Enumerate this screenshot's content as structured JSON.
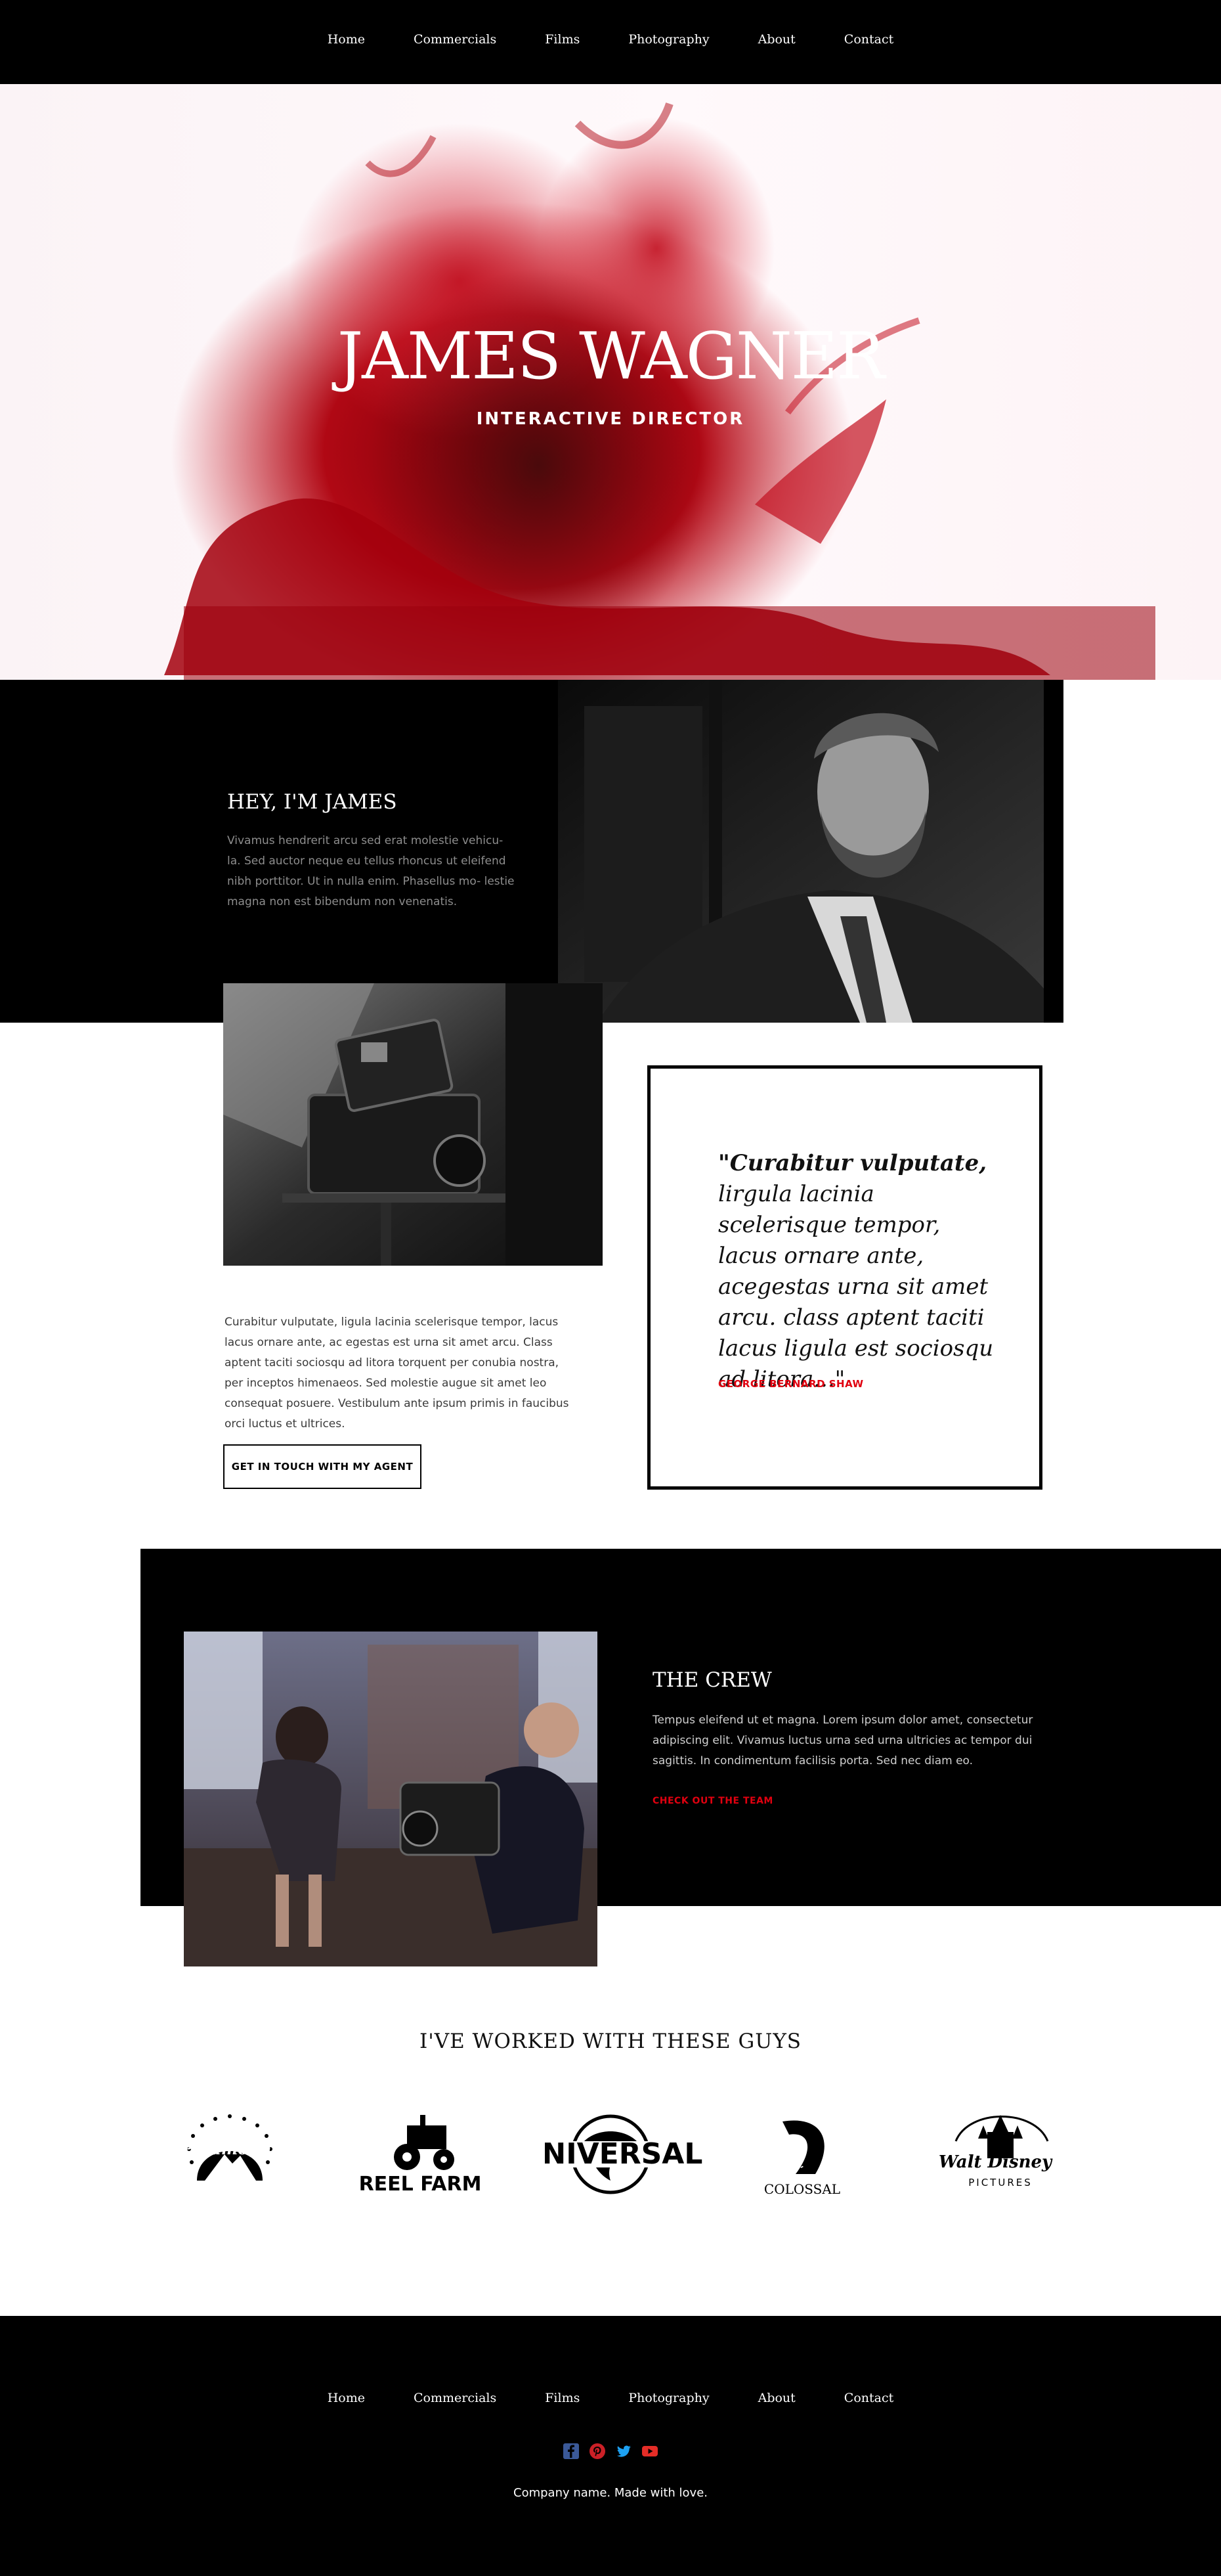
{
  "nav": {
    "items": [
      "Home",
      "Commercials",
      "Films",
      "Photography",
      "About",
      "Contact"
    ]
  },
  "hero": {
    "title": "JAMES WAGNER",
    "subtitle": "INTERACTIVE DIRECTOR"
  },
  "about": {
    "title": "HEY, I'M JAMES",
    "text": "Vivamus hendrerit arcu sed erat molestie vehicu- la. Sed auctor neque eu tellus rhoncus ut eleifend nibh porttitor. Ut in nulla enim. Phasellus mo- lestie magna non est bibendum non venenatis."
  },
  "intro": {
    "text": "Curabitur vulputate, ligula lacinia scelerisque tempor, lacus lacus ornare ante, ac egestas est urna sit amet arcu. Class aptent taciti sociosqu ad litora torquent per conubia nostra, per inceptos himenaeos. Sed molestie augue sit amet leo consequat posuere. Vestibulum ante ipsum primis in faucibus orci luctus et ultrices.",
    "button_label": "GET IN TOUCH WITH MY AGENT"
  },
  "quote": {
    "lead": "\"Curabitur vulputate,",
    "rest": "lirgula lacinia scelerisque tempor, lacus ornare ante, acegestas urna sit amet arcu. class aptent taciti lacus ligula est sociosqu ad litora...\"",
    "author": "GEORGE BERNARD SHAW"
  },
  "crew": {
    "title": "THE CREW",
    "text": "Tempus eleifend ut et magna. Lorem ipsum dolor amet, consectetur adipiscing elit. Vivamus luctus urna sed urna ultricies ac tempor dui sagittis. In condimentum facilisis porta. Sed nec diam eo.",
    "link": "CHECK OUT THE TEAM"
  },
  "partners": {
    "title": "I'VE WORKED WITH THESE GUYS",
    "logos": [
      {
        "name": "paramount",
        "text": "Paramount"
      },
      {
        "name": "reel-farm",
        "text": "REEL FARM"
      },
      {
        "name": "universal",
        "text": "UNIVERSAL"
      },
      {
        "name": "colossal",
        "text": "COLOSSAL"
      },
      {
        "name": "walt-disney",
        "text": "Walt Disney",
        "sub": "PICTURES"
      }
    ]
  },
  "footer": {
    "nav": [
      "Home",
      "Commercials",
      "Films",
      "Photography",
      "About",
      "Contact"
    ],
    "social": [
      {
        "icon": "facebook-icon",
        "color": "#3b5998"
      },
      {
        "icon": "pinterest-icon",
        "color": "#cb2027"
      },
      {
        "icon": "twitter-icon",
        "color": "#1da1f2"
      },
      {
        "icon": "youtube-icon",
        "color": "#e52d27"
      }
    ],
    "copyright": "Company name. Made with love."
  }
}
